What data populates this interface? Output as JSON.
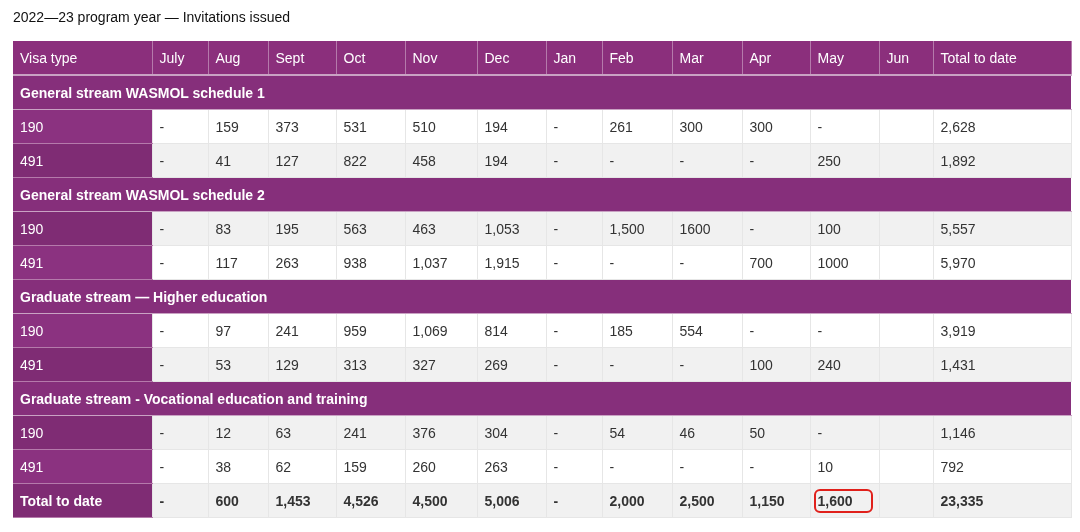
{
  "title": "2022—23 program year — Invitations issued",
  "table": {
    "columns": [
      "Visa type",
      "July",
      "Aug",
      "Sept",
      "Oct",
      "Nov",
      "Dec",
      "Jan",
      "Feb",
      "Mar",
      "Apr",
      "May",
      "Jun",
      "Total to date"
    ],
    "groups": [
      {
        "heading": "General stream WASMOL schedule 1",
        "rows": [
          {
            "visa": "190",
            "values": [
              "-",
              "159",
              "373",
              "531",
              "510",
              "194",
              "-",
              "261",
              "300",
              "300",
              "-"
            ],
            "total": "2,628"
          },
          {
            "visa": "491",
            "values": [
              "-",
              "41",
              "127",
              "822",
              "458",
              "194",
              "-",
              "-",
              "-",
              "-",
              "250"
            ],
            "total": "1,892"
          }
        ]
      },
      {
        "heading": "General stream WASMOL schedule 2",
        "rows": [
          {
            "visa": "190",
            "values": [
              "-",
              "83",
              "195",
              "563",
              "463",
              "1,053",
              "-",
              "1,500",
              "1600",
              "-",
              "100"
            ],
            "total": "5,557"
          },
          {
            "visa": "491",
            "values": [
              "-",
              "117",
              "263",
              "938",
              "1,037",
              "1,915",
              "-",
              "-",
              "-",
              "700",
              "1000"
            ],
            "total": "5,970"
          }
        ]
      },
      {
        "heading": "Graduate stream — Higher education",
        "rows": [
          {
            "visa": "190",
            "values": [
              "-",
              "97",
              "241",
              "959",
              "1,069",
              "814",
              "-",
              "185",
              "554",
              "-",
              "-"
            ],
            "total": "3,919"
          },
          {
            "visa": "491",
            "values": [
              "-",
              "53",
              "129",
              "313",
              "327",
              "269",
              "-",
              "-",
              "-",
              "100",
              "240"
            ],
            "total": "1,431"
          }
        ]
      },
      {
        "heading": "Graduate stream - Vocational education and training",
        "rows": [
          {
            "visa": "190",
            "values": [
              "-",
              "12",
              "63",
              "241",
              "376",
              "304",
              "-",
              "54",
              "46",
              "50",
              "-"
            ],
            "total": "1,146"
          },
          {
            "visa": "491",
            "values": [
              "-",
              "38",
              "62",
              "159",
              "260",
              "263",
              "-",
              "-",
              "-",
              "-",
              "10"
            ],
            "total": "792"
          }
        ]
      }
    ],
    "total_row": {
      "label": "Total to date",
      "cells": [
        {
          "text": "-",
          "highlighted": false
        },
        {
          "text": "600",
          "highlighted": false
        },
        {
          "text": "1,453",
          "highlighted": false
        },
        {
          "text": "4,526",
          "highlighted": false
        },
        {
          "text": "4,500",
          "highlighted": false
        },
        {
          "text": "5,006",
          "highlighted": false
        },
        {
          "text": "-",
          "highlighted": false
        },
        {
          "text": "2,000",
          "highlighted": false
        },
        {
          "text": "2,500",
          "highlighted": false
        },
        {
          "text": "1,150",
          "highlighted": false
        },
        {
          "text": "1,600",
          "highlighted": true
        }
      ],
      "total": "23,335"
    }
  }
}
